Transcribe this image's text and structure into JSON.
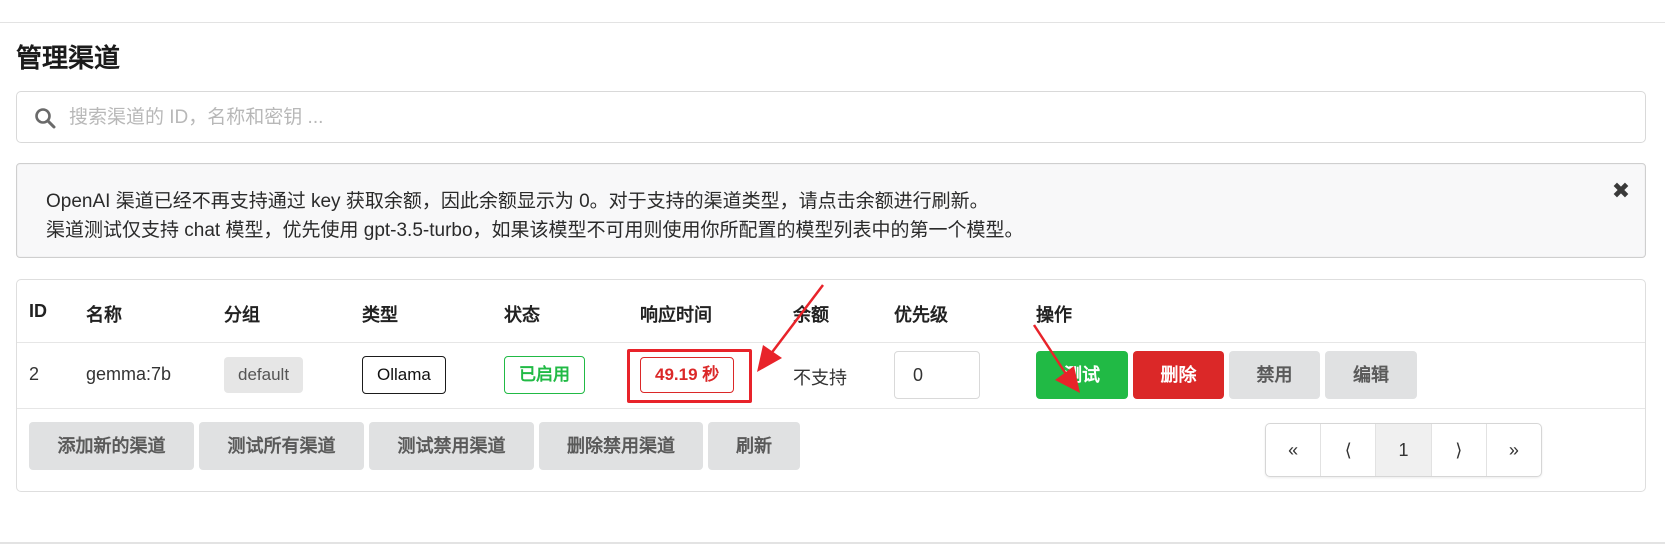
{
  "page": {
    "title": "管理渠道"
  },
  "search": {
    "placeholder": "搜索渠道的 ID，名称和密钥 ..."
  },
  "notice": {
    "line1": "OpenAI 渠道已经不再支持通过 key 获取余额，因此余额显示为 0。对于支持的渠道类型，请点击余额进行刷新。",
    "line2": "渠道测试仅支持 chat 模型，优先使用 gpt-3.5-turbo，如果该模型不可用则使用你所配置的模型列表中的第一个模型。",
    "close_glyph": "✖"
  },
  "table": {
    "headers": [
      "ID",
      "名称",
      "分组",
      "类型",
      "状态",
      "响应时间",
      "余额",
      "优先级",
      "操作"
    ],
    "rows": [
      {
        "id": "2",
        "name": "gemma:7b",
        "group": "default",
        "type": "Ollama",
        "status": "已启用",
        "response_time": "49.19 秒",
        "balance": "不支持",
        "priority": "0",
        "actions": {
          "test": "测试",
          "delete": "删除",
          "disable": "禁用",
          "edit": "编辑"
        }
      }
    ]
  },
  "footer": {
    "add_channel": "添加新的渠道",
    "test_all": "测试所有渠道",
    "test_disabled": "测试禁用渠道",
    "delete_disabled": "删除禁用渠道",
    "refresh": "刷新"
  },
  "pagination": {
    "first": "«",
    "prev": "⟨",
    "current": "1",
    "next": "⟩",
    "last": "»"
  },
  "colors": {
    "green": "#21ba45",
    "red": "#db2828",
    "grey": "#e0e1e2",
    "annotation_red": "#e8232a"
  }
}
